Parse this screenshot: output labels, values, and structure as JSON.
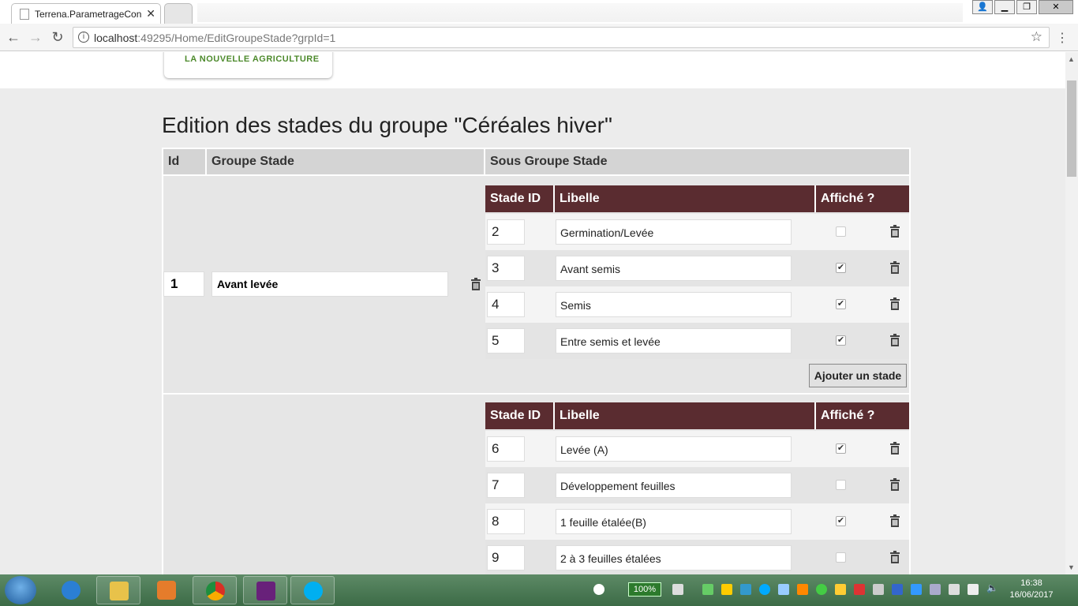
{
  "browser": {
    "tab_title": "Terrena.ParametrageCon",
    "tab_close": "✕",
    "url_host": "localhost",
    "url_rest": ":49295/Home/EditGroupeStade?grpId=1",
    "bookmark_icon": "star-outline-icon"
  },
  "logo": {
    "tagline": "LA NOUVELLE AGRICULTURE"
  },
  "page": {
    "title": "Edition des stades du groupe \"Céréales hiver\"",
    "headers": {
      "id": "Id",
      "groupe": "Groupe Stade",
      "sous_groupe": "Sous Groupe Stade"
    },
    "sub_headers": {
      "stade_id": "Stade ID",
      "libelle": "Libelle",
      "affiche": "Affiché ?"
    },
    "add_label": "Ajouter un stade",
    "groups": [
      {
        "id": "1",
        "name": "Avant levée",
        "stades": [
          {
            "id": "2",
            "libelle": "Germination/Levée",
            "affiche": false
          },
          {
            "id": "3",
            "libelle": "Avant semis",
            "affiche": true
          },
          {
            "id": "4",
            "libelle": "Semis",
            "affiche": true
          },
          {
            "id": "5",
            "libelle": "Entre semis et levée",
            "affiche": true
          }
        ]
      },
      {
        "id": "",
        "name": "",
        "stades": [
          {
            "id": "6",
            "libelle": "Levée (A)",
            "affiche": true
          },
          {
            "id": "7",
            "libelle": "Développement feuilles",
            "affiche": false
          },
          {
            "id": "8",
            "libelle": "1 feuille étalée(B)",
            "affiche": true
          },
          {
            "id": "9",
            "libelle": "2 à 3 feuilles étalées",
            "affiche": false
          }
        ]
      }
    ]
  },
  "taskbar": {
    "battery": "100%",
    "time": "16:38",
    "date": "16/06/2017"
  },
  "colors": {
    "subheader_bg": "#5a2c30",
    "logo_green": "#4d8a2c",
    "taskbar": "#4a7a52"
  }
}
